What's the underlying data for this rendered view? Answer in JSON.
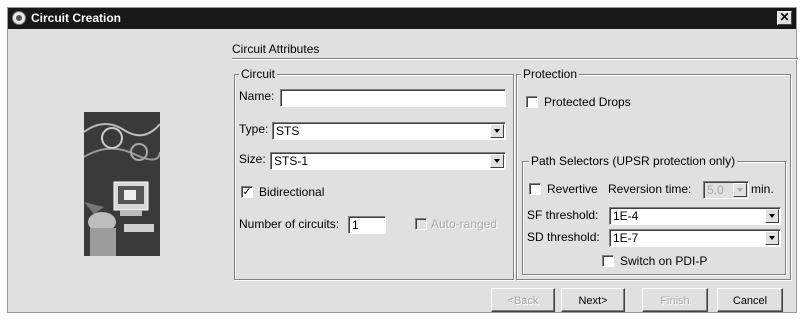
{
  "window": {
    "title": "Circuit Creation",
    "title_icon": "circuit-globe-icon",
    "close_glyph": "✕"
  },
  "section": {
    "title": "Circuit Attributes"
  },
  "circuit": {
    "legend": "Circuit",
    "name_label": "Name:",
    "name_value": "",
    "type_label": "Type:",
    "type_value": "STS",
    "size_label": "Size:",
    "size_value": "STS-1",
    "bidirectional_label": "Bidirectional",
    "bidirectional_checked": true,
    "num_label": "Number of circuits:",
    "num_value": "1",
    "auto_ranged_label": "Auto-ranged",
    "auto_ranged_checked": false
  },
  "protection": {
    "legend": "Protection",
    "protected_drops_label": "Protected Drops",
    "protected_drops_checked": false,
    "path_selectors": {
      "legend": "Path Selectors (UPSR protection only)",
      "revertive_label": "Revertive",
      "revertive_checked": false,
      "reversion_label": "Reversion time:",
      "reversion_value": "5.0",
      "reversion_unit": "min.",
      "sf_label": "SF threshold:",
      "sf_value": "1E-4",
      "sd_label": "SD threshold:",
      "sd_value": "1E-7",
      "switch_pdi_label": "Switch on PDI-P",
      "switch_pdi_checked": false
    }
  },
  "buttons": {
    "back": "<Back",
    "next": "Next>",
    "finish": "Finish",
    "cancel": "Cancel"
  },
  "check_glyph": "✓"
}
